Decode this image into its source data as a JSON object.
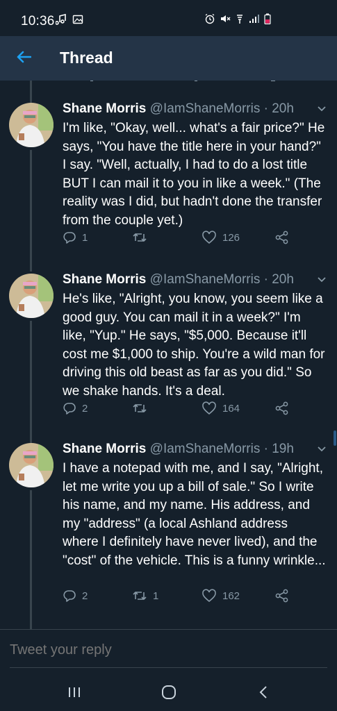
{
  "status_bar": {
    "time": "10:36"
  },
  "header": {
    "title": "Thread"
  },
  "tweets": [
    {
      "name": "Shane Morris",
      "handle": "@IamShaneMorris",
      "time": "· 20h",
      "text": "I'm like, \"Okay, well... what's a fair price?\" He says, \"You have the title here in your hand?\" I say. \"Well, actually, I had to do a lost title BUT I can mail it to you in like a week.\" (The reality was I did, but hadn't done the transfer from the couple yet.)",
      "replies": "1",
      "retweets": "",
      "likes": "126"
    },
    {
      "name": "Shane Morris",
      "handle": "@IamShaneMorris",
      "time": "· 20h",
      "text": "He's like, \"Alright, you know, you seem like a good guy. You can mail it in a week?\" I'm like, \"Yup.\" He says, \"$5,000. Because it'll cost me $1,000 to ship. You're a wild man for driving this old beast as far as you did.\" So we shake hands. It's a deal.",
      "replies": "2",
      "retweets": "",
      "likes": "164"
    },
    {
      "name": "Shane Morris",
      "handle": "@IamShaneMorris",
      "time": "· 19h",
      "text": "I have a notepad with me, and I say, \"Alright, let me write you up a bill of sale.\" So I write his name, and my name. His address, and my \"address\" (a local Ashland address where I definitely have never lived), and the \"cost\" of the vehicle. This is a funny wrinkle...",
      "replies": "2",
      "retweets": "1",
      "likes": "162"
    }
  ],
  "reply": {
    "placeholder": "Tweet your reply"
  },
  "colors": {
    "background": "#15202b",
    "header": "#243447",
    "accent": "#1da1f2",
    "secondary_text": "#8899a6"
  }
}
